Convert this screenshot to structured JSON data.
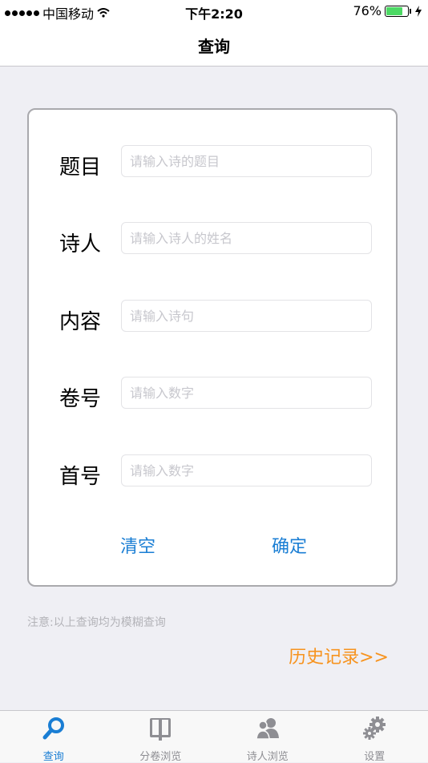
{
  "status_bar": {
    "carrier": "中国移动",
    "time": "下午2:20",
    "battery_percent": "76%",
    "battery_level": 0.76
  },
  "nav": {
    "title": "查询"
  },
  "form": {
    "fields": [
      {
        "label": "题目",
        "placeholder": "请输入诗的题目",
        "value": ""
      },
      {
        "label": "诗人",
        "placeholder": "请输入诗人的姓名",
        "value": ""
      },
      {
        "label": "内容",
        "placeholder": "请输入诗句",
        "value": ""
      },
      {
        "label": "卷号",
        "placeholder": "请输入数字",
        "value": ""
      },
      {
        "label": "首号",
        "placeholder": "请输入数字",
        "value": ""
      }
    ],
    "clear_label": "清空",
    "confirm_label": "确定"
  },
  "note": "注意:以上查询均为模糊查询",
  "history_link": "历史记录>>",
  "tabs": [
    {
      "label": "查询",
      "icon": "search-icon",
      "active": true
    },
    {
      "label": "分卷浏览",
      "icon": "book-icon",
      "active": false
    },
    {
      "label": "诗人浏览",
      "icon": "people-icon",
      "active": false
    },
    {
      "label": "设置",
      "icon": "gear-icon",
      "active": false
    }
  ],
  "colors": {
    "accent": "#1a7ed4",
    "history": "#f7931e",
    "battery": "#4cd964"
  }
}
